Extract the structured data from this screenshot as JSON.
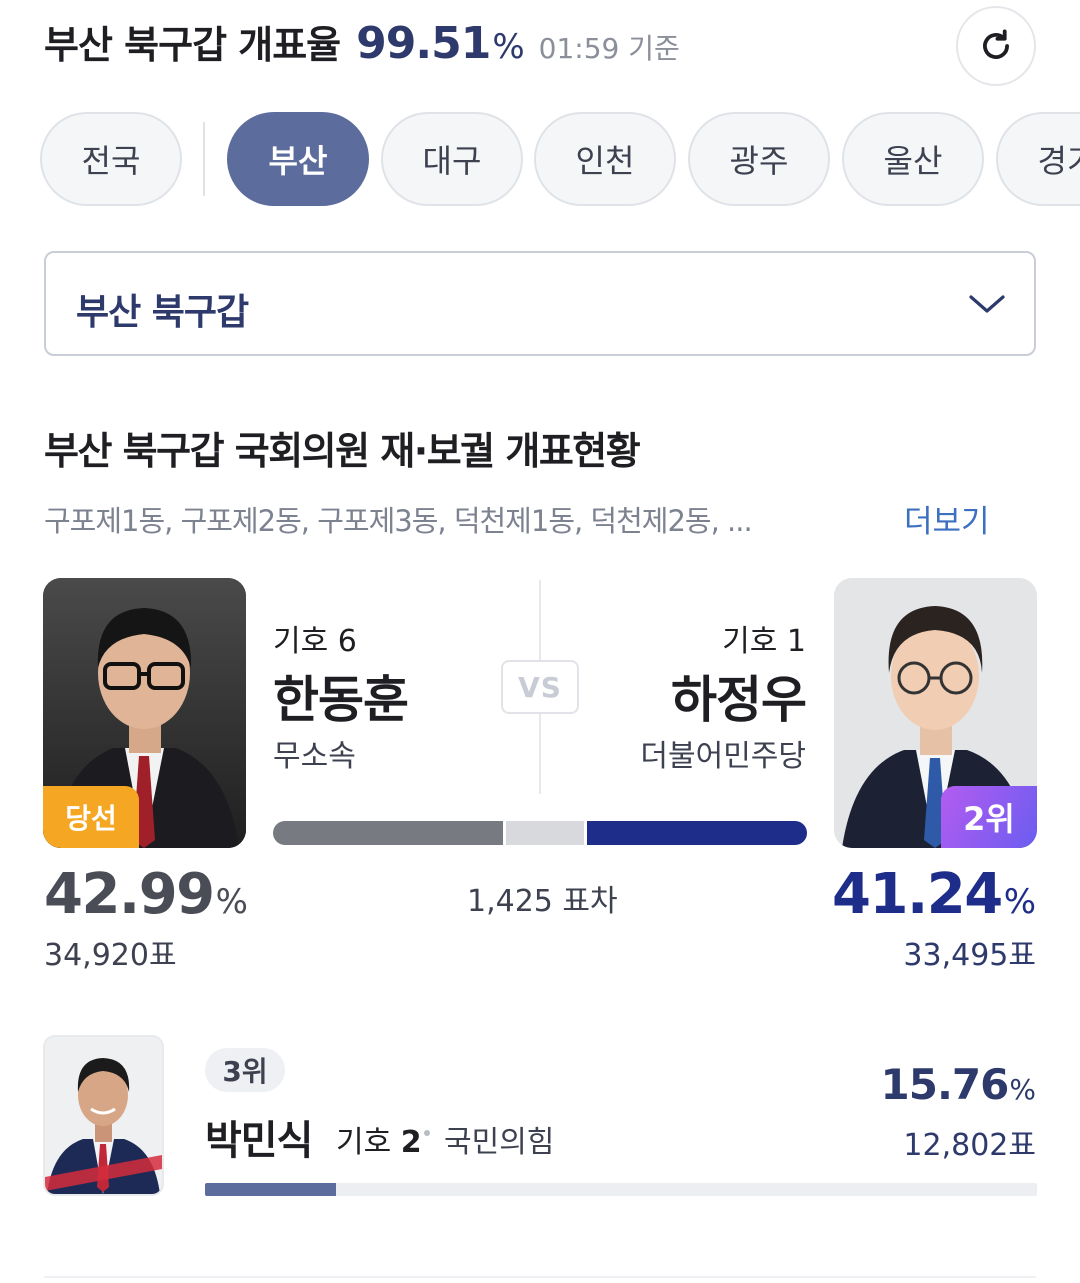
{
  "header": {
    "title": "부산 북구갑 개표율",
    "rate": "99.51",
    "rate_unit": "%",
    "time": "01:59 기준",
    "refresh_icon": "refresh-icon"
  },
  "regions": [
    {
      "label": "전국",
      "active": false
    },
    {
      "label": "부산",
      "active": true
    },
    {
      "label": "대구",
      "active": false
    },
    {
      "label": "인천",
      "active": false
    },
    {
      "label": "광주",
      "active": false
    },
    {
      "label": "울산",
      "active": false
    },
    {
      "label": "경기",
      "active": false
    }
  ],
  "district_select": {
    "selected": "부산 북구갑",
    "icon": "chevron-down-icon"
  },
  "section": {
    "title": "부산 북구갑 국회의원 재·보궐 개표현황",
    "districts": "구포제1동, 구포제2동, 구포제3동, 덕천제1동, 덕천제2동,  ...",
    "more_label": "더보기"
  },
  "candidates": [
    {
      "number": "기호 6",
      "name": "한동훈",
      "party": "무소속",
      "badge": "당선",
      "percent": "42.99",
      "percent_unit": "%",
      "votes": "34,920표",
      "share": 42.99,
      "color": "#777a80"
    },
    {
      "number": "기호 1",
      "name": "하정우",
      "party": "더불어민주당",
      "badge": "2위",
      "percent": "41.24",
      "percent_unit": "%",
      "votes": "33,495표",
      "share": 41.24,
      "color": "#1f2d8a"
    }
  ],
  "vs_label": "VS",
  "margin_text": "1,425 표차",
  "third": {
    "rank": "3위",
    "name": "박민식",
    "number_prefix": "기호",
    "number": "2",
    "party": "국민의힘",
    "percent": "15.76",
    "percent_unit": "%",
    "votes": "12,802표",
    "share": 15.76,
    "color": "#5c6c9c"
  }
}
